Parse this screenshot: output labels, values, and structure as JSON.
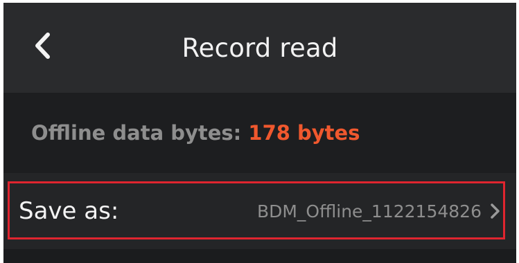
{
  "header": {
    "title": "Record read",
    "back_icon": "chevron-left-icon"
  },
  "info": {
    "label": "Offline data bytes: ",
    "value": "178 bytes",
    "value_color": "#f0582e"
  },
  "save_row": {
    "label": "Save as:",
    "value": "BDM_Offline_1122154826",
    "chevron_icon": "chevron-right-icon"
  },
  "highlight": {
    "color": "#e0252f"
  }
}
